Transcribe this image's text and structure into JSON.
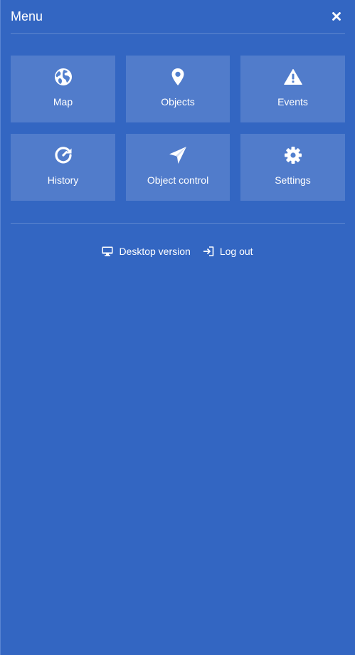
{
  "header": {
    "title": "Menu",
    "close_icon": "close-icon"
  },
  "tiles": [
    {
      "label": "Map",
      "icon": "globe-icon"
    },
    {
      "label": "Objects",
      "icon": "map-marker-icon"
    },
    {
      "label": "Events",
      "icon": "warning-icon"
    },
    {
      "label": "History",
      "icon": "history-icon"
    },
    {
      "label": "Object control",
      "icon": "paper-plane-icon"
    },
    {
      "label": "Settings",
      "icon": "gear-icon"
    }
  ],
  "footer": {
    "desktop_label": "Desktop version",
    "desktop_icon": "monitor-icon",
    "logout_label": "Log out",
    "logout_icon": "sign-in-icon"
  },
  "colors": {
    "background": "#3366c2",
    "tile": "#5280cf",
    "text": "#ffffff"
  }
}
